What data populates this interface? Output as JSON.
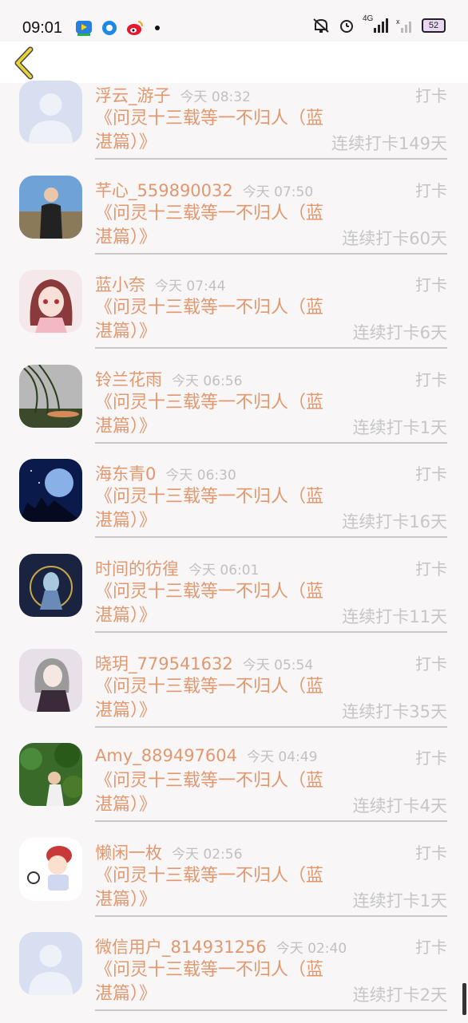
{
  "status_bar": {
    "time": "09:01",
    "app_icons": [
      "video-app-icon",
      "browser-icon",
      "weibo-icon"
    ],
    "network_label": "4G",
    "battery_level": "52"
  },
  "nav": {
    "back_icon": "chevron-left-icon"
  },
  "items": [
    {
      "name": "浮云_游子",
      "time": "今天 08:32",
      "action": "打卡",
      "title": "《问灵十三载等一不归人（蓝湛篇）》",
      "streak": "连续打卡149天",
      "avatar": "default"
    },
    {
      "name": "芊心_559890032",
      "time": "今天 07:50",
      "action": "打卡",
      "title": "《问灵十三载等一不归人（蓝湛篇）》",
      "streak": "连续打卡60天",
      "avatar": "person"
    },
    {
      "name": "蓝小奈",
      "time": "今天 07:44",
      "action": "打卡",
      "title": "《问灵十三载等一不归人（蓝湛篇）》",
      "streak": "连续打卡6天",
      "avatar": "anime-girl"
    },
    {
      "name": "铃兰花雨",
      "time": "今天 06:56",
      "action": "打卡",
      "title": "《问灵十三载等一不归人（蓝湛篇）》",
      "streak": "连续打卡1天",
      "avatar": "willow"
    },
    {
      "name": "海东青0",
      "time": "今天 06:30",
      "action": "打卡",
      "title": "《问灵十三载等一不归人（蓝湛篇）》",
      "streak": "连续打卡16天",
      "avatar": "night-moon"
    },
    {
      "name": "时间的彷徨",
      "time": "今天 06:01",
      "action": "打卡",
      "title": "《问灵十三载等一不归人（蓝湛篇）》",
      "streak": "连续打卡11天",
      "avatar": "fantasy"
    },
    {
      "name": "晓玥_779541632",
      "time": "今天 05:54",
      "action": "打卡",
      "title": "《问灵十三载等一不归人（蓝湛篇）》",
      "streak": "连续打卡35天",
      "avatar": "gothic-girl"
    },
    {
      "name": "Amy_889497604",
      "time": "今天 04:49",
      "action": "打卡",
      "title": "《问灵十三载等一不归人（蓝湛篇）》",
      "streak": "连续打卡4天",
      "avatar": "forest"
    },
    {
      "name": "懒闲一枚",
      "time": "今天 02:56",
      "action": "打卡",
      "title": "《问灵十三载等一不归人（蓝湛篇）》",
      "streak": "连续打卡1天",
      "avatar": "cartoon"
    },
    {
      "name": "微信用户_814931256",
      "time": "今天 02:40",
      "action": "打卡",
      "title": "《问灵十三载等一不归人（蓝湛篇）》",
      "streak": "连续打卡2天",
      "avatar": "default"
    }
  ]
}
